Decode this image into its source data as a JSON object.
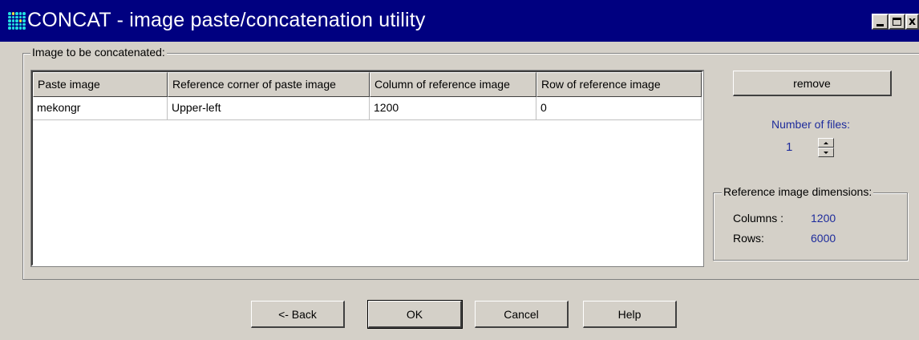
{
  "window": {
    "title": "CONCAT - image paste/concatenation utility",
    "controls": [
      "minimize",
      "maximize",
      "close"
    ],
    "close_glyph": "x"
  },
  "group": {
    "label": "Image to be concatenated:"
  },
  "table": {
    "columns": [
      "Paste image",
      "Reference corner of paste image",
      "Column of reference image",
      "Row of reference image"
    ],
    "rows": [
      [
        "mekongr",
        "Upper-left",
        "1200",
        "0"
      ]
    ]
  },
  "sidebar": {
    "remove_label": "remove",
    "number_of_files_label": "Number of files:",
    "number_of_files_value": "1",
    "reference_dimensions": {
      "label": "Reference image dimensions:",
      "columns_label": "Columns :",
      "columns_value": "1200",
      "rows_label": "Rows:",
      "rows_value": "6000"
    }
  },
  "buttons": {
    "back": "<- Back",
    "ok": "OK",
    "cancel": "Cancel",
    "help": "Help"
  },
  "colors": {
    "titlebar": "#000080",
    "face": "#d4d0c8",
    "accent_text": "#1e2c9c"
  }
}
